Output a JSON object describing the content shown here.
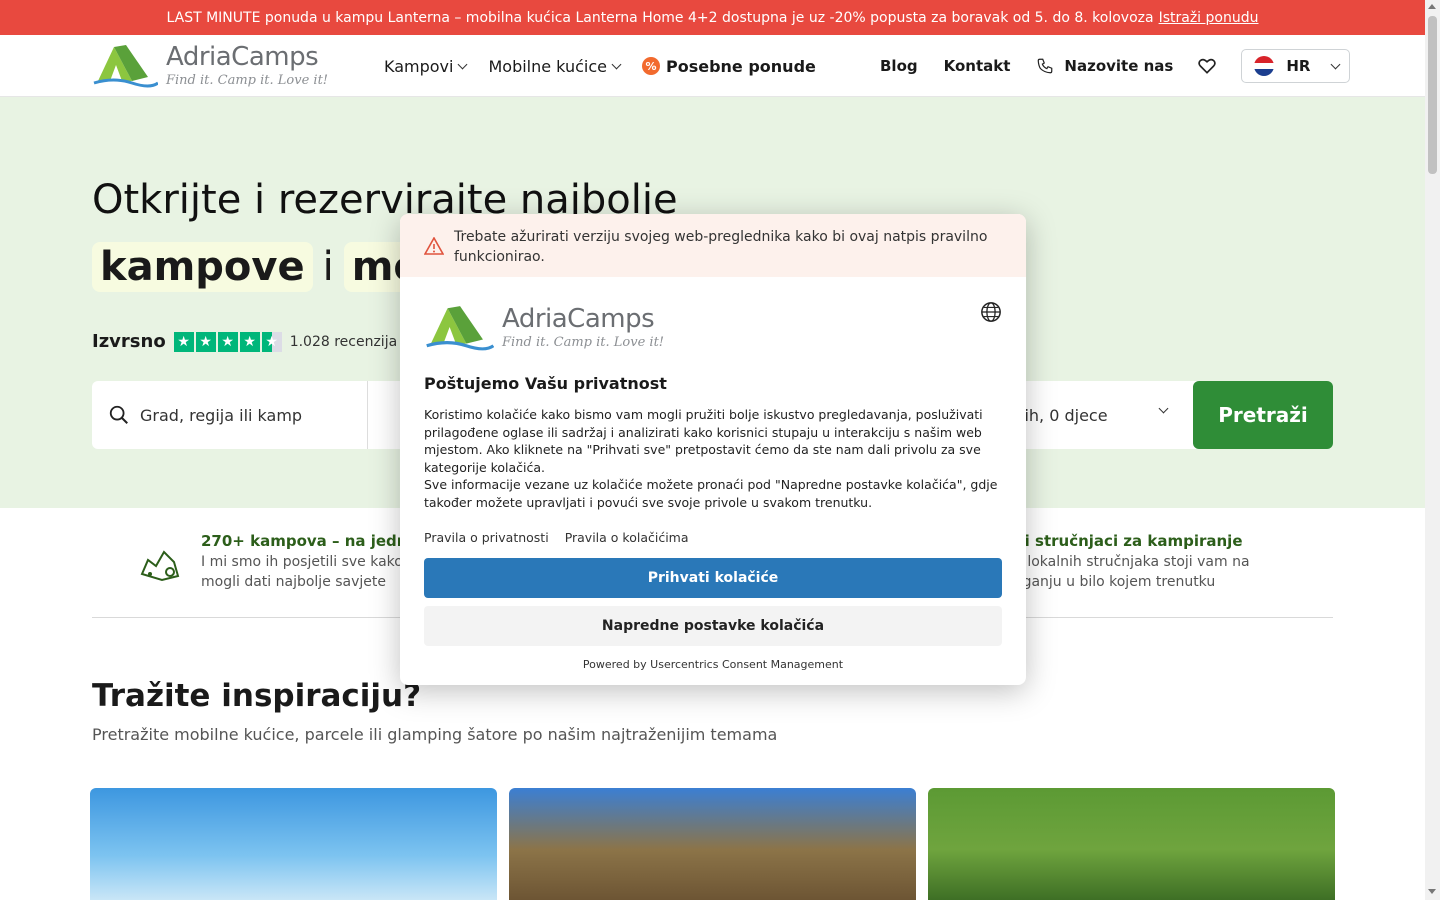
{
  "promo": {
    "text": "LAST MINUTE ponuda u kampu Lanterna – mobilna kućica Lanterna Home 4+2 dostupna je uz -20% popusta za boravak od 5. do 8. kolovoza",
    "link": "Istraži ponudu"
  },
  "brand": {
    "name": "AdriaCamps",
    "tagline": "Find it. Camp it. Love it!"
  },
  "nav": {
    "kampovi": "Kampovi",
    "mobilne": "Mobilne kućice",
    "special": "Posebne ponude",
    "blog": "Blog",
    "kontakt": "Kontakt",
    "phone": "Nazovite nas",
    "lang": "HR"
  },
  "hero": {
    "title": "Otkrijte i rezervirajte najbolje",
    "word1": "kampove",
    "conj": "i",
    "word2": "mo",
    "rating_label": "Izvrsno",
    "reviews": "1.028 recenzija",
    "stars": 4.5
  },
  "search": {
    "placeholder": "Grad, regija ili kamp",
    "guests": "lih, 0 djece",
    "button": "Pretraži"
  },
  "features": [
    {
      "title": "270+ kampova – na jedr",
      "text1": "I mi smo ih posjetili sve kako",
      "text2": "mogli dati najbolje savjete"
    },
    {
      "title": "ni stručnjaci za kampiranje",
      "text1": "n lokalnih stručnjaka stoji vam na",
      "text2": "aganju u bilo kojem trenutku"
    }
  ],
  "inspiration": {
    "title": "Tražite inspiraciju?",
    "subtitle": "Pretražite mobilne kućice, parcele ili glamping šatore po našim najtraženijim temama"
  },
  "consent": {
    "warning": "Trebate ažurirati verziju svojeg web-preglednika kako bi ovaj natpis pravilno funkcionirao.",
    "title": "Poštujemo Vašu privatnost",
    "body1": "Koristimo kolačiće kako bismo vam mogli pružiti bolje iskustvo pregledavanja, posluživati prilagođene oglase ili sadržaj i analizirati kako korisnici stupaju u interakciju s našim web mjestom. Ako kliknete na \"Prihvati sve\" pretpostavit ćemo da ste nam dali privolu za sve kategorije kolačića.",
    "body2": "Sve informacije vezane uz kolačiće možete pronaći pod \"Napredne postavke kolačića\", gdje također možete upravljati i povući sve svoje privole u svakom trenutku.",
    "privacy_link": "Pravila o privatnosti",
    "cookie_link": "Pravila o kolačićima",
    "accept": "Prihvati kolačiće",
    "advanced": "Napredne postavke kolačića",
    "powered": "Powered by Usercentrics Consent Management"
  },
  "colors": {
    "promo": "#e8493f",
    "hero_bg": "#e8f3e3",
    "search_btn": "#2f8d37",
    "accept_btn": "#2a78b8",
    "stars": "#00b67a"
  }
}
